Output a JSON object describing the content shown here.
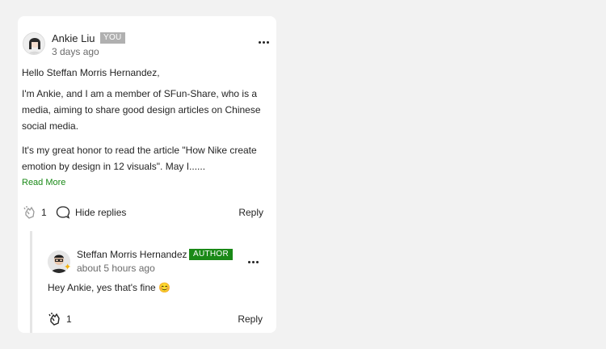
{
  "comment": {
    "author": "Ankie Liu",
    "badge": "YOU",
    "time": "3 days ago",
    "paragraphs": [
      "Hello Steffan Morris Hernandez,",
      "I'm Ankie, and I am a member of SFun-Share, who is a media, aiming to share good design articles on Chinese social media.",
      "It's my great honor to read the article \"How Nike create emotion by design in 12 visuals\". May I......"
    ],
    "read_more": "Read More",
    "clap_count": "1",
    "hide_replies": "Hide replies",
    "reply": "Reply"
  },
  "reply": {
    "author": "Steffan Morris Hernandez",
    "badge": "AUTHOR",
    "time": "about 5 hours ago",
    "text": "Hey Ankie, yes that's fine",
    "emoji": "😊",
    "clap_count": "1",
    "reply": "Reply"
  },
  "colors": {
    "accent_green": "#1a8917",
    "you_badge": "#b0b0b0",
    "background": "#f2f2f2"
  },
  "icons": [
    "clap-icon",
    "reply-bubble-icon",
    "more-icon",
    "sparkle-icon"
  ]
}
